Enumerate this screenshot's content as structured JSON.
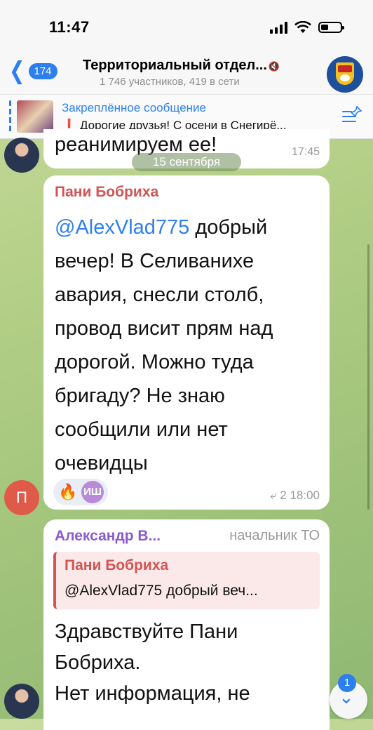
{
  "status_bar": {
    "time": "11:47"
  },
  "header": {
    "back_count": "174",
    "title": "Территориальный отдел...",
    "mute_icon": "speaker-muted-icon",
    "subtitle": "1 746 участников, 419 в сети",
    "avatar_icon": "coat-of-arms-icon"
  },
  "pinned": {
    "title": "Закреплённое сообщение",
    "text": "Дорогие друзья! С осени в Снегирё..."
  },
  "messages": {
    "top_fragment": {
      "text": "реанимируем ее!",
      "time": "17:45"
    },
    "date_divider": "15 сентября",
    "msg1": {
      "sender": "Пани Бобриха",
      "mention": "@AlexVlad775",
      "text": " добрый вечер! В Селиванихе авария, снесли столб, провод висит прям над дорогой. Можно туда бригаду? Не знаю сообщили или нет очевидцы",
      "reaction_emoji": "🔥",
      "reaction_avatar": "ИШ",
      "replies": "2",
      "time": "18:00",
      "avatar_letter": "П"
    },
    "msg2": {
      "sender": "Александр В...",
      "tag": "начальник ТО",
      "quote_sender": "Пани Бобриха",
      "quote_text": "@AlexVlad775 добрый веч...",
      "text": "Здравствуйте Пани Бобриха.\nНет информация, не"
    }
  },
  "scroll_down": {
    "unread": "1"
  },
  "colors": {
    "accent": "#2d7ff0",
    "sender_red": "#d05555",
    "sender_purple": "#8a5bd0"
  }
}
